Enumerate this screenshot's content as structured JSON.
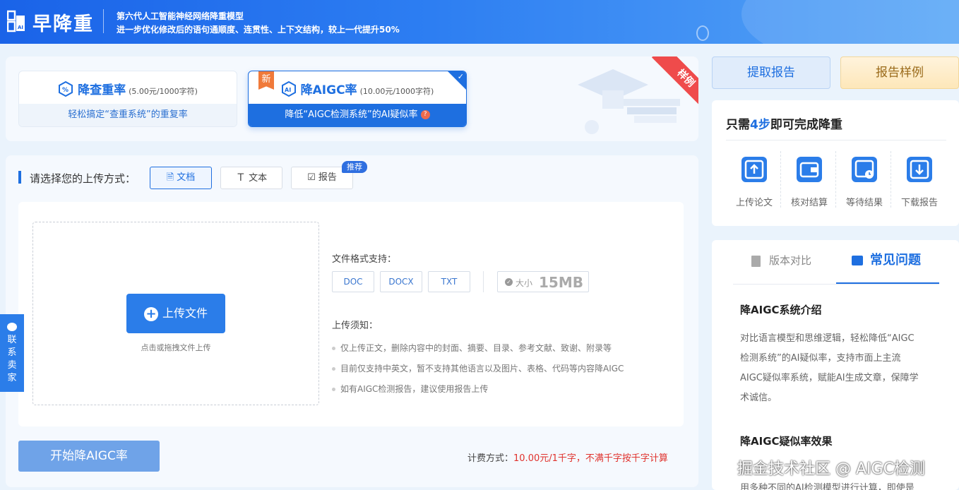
{
  "banner": {
    "logo_badge": "AI",
    "logo_text": "早降重",
    "line1": "第六代人工智能神经网络降重模型",
    "line2": "进一步优化修改后的语句通顺度、连贯性、上下文结构，较上一代提升50%"
  },
  "modes": {
    "check": {
      "title": "降查重率",
      "price": "(5.00元/1000字符)",
      "desc": "轻松搞定“查重系统”的重复率"
    },
    "aigc": {
      "badge": "新",
      "title": "降AIGC率",
      "price": "(10.00元/1000字符)",
      "desc": "降低“AIGC检测系统”的AI疑似率",
      "help": "?"
    },
    "sample_ribbon": "样例"
  },
  "upload": {
    "prompt": "请选择您的上传方式：",
    "tabs": [
      {
        "label": "文档"
      },
      {
        "label": "文本"
      },
      {
        "label": "报告"
      }
    ],
    "recommend_badge": "推荐",
    "upload_button": "上传文件",
    "drag_hint": "点击或拖拽文件上传",
    "formats_label": "文件格式支持：",
    "formats": [
      "DOC",
      "DOCX",
      "TXT"
    ],
    "size_label": "大小",
    "size_value": "15MB",
    "notice_label": "上传须知：",
    "notices": [
      "仅上传正文，删除内容中的封面、摘要、目录、参考文献、致谢、附录等",
      "目前仅支持中英文，暂不支持其他语言以及图片、表格、代码等内容降AIGC",
      "如有AIGC检测报告，建议使用报告上传"
    ]
  },
  "footer": {
    "start_button": "开始降AIGC率",
    "billing_label": "计费方式：",
    "billing_value": "10.00元/1千字，不满千字按千字计算"
  },
  "side_contact": "联系卖家",
  "right": {
    "btn_fetch": "提取报告",
    "btn_sample": "报告样例",
    "steps_prefix": "只需",
    "steps_num": "4步",
    "steps_suffix": "即可完成降重",
    "steps": [
      "上传论文",
      "核对结算",
      "等待结果",
      "下载报告"
    ],
    "tab_compare": "版本对比",
    "tab_faq": "常见问题",
    "faq1_title": "降AIGC系统介绍",
    "faq1_lines": [
      "对比语言模型和思维逻辑，轻松降低“AIGC",
      "检测系统”的AI疑似率，支持市面上主流",
      "AIGC疑似率系统，赋能AI生成文章，保障学",
      "术诚信。"
    ],
    "faq2_title": "降AIGC疑似率效果",
    "faq2_line": "用多种不同的AI检测模型进行计算，即使是"
  },
  "watermark": "掘金技术社区 @ AIGC检测",
  "colors": {
    "primary": "#1e6fe0",
    "accent_red": "#e0322d",
    "orange_badge": "#f07a3a"
  }
}
